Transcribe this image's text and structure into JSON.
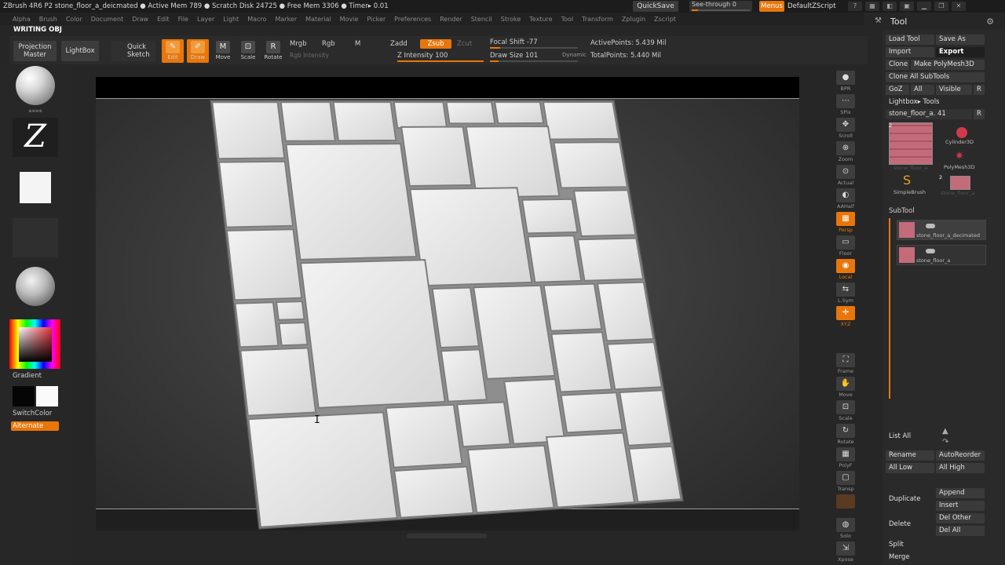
{
  "titlebar": {
    "app_title": "ZBrush 4R6 P2    stone_floor_a_deicmated    ● Active Mem 789 ● Scratch Disk 24725 ● Free Mem 3306 ● Timer▸ 0.01",
    "quicksave": "QuickSave",
    "see_through": "See-through   0",
    "see_through_value": 0,
    "menus": "Menus",
    "script": "DefaultZScript"
  },
  "menu": [
    "Alpha",
    "Brush",
    "Color",
    "Document",
    "Draw",
    "Edit",
    "File",
    "Layer",
    "Light",
    "Macro",
    "Marker",
    "Material",
    "Movie",
    "Picker",
    "Preferences",
    "Render",
    "Stencil",
    "Stroke",
    "Texture",
    "Tool",
    "Transform",
    "Zplugin",
    "Zscript"
  ],
  "document_label": "WRITING OBJ",
  "shelf": {
    "projection_master": "Projection Master",
    "lightbox": "LightBox",
    "quick_sketch": "Quick Sketch",
    "edit": "Edit",
    "draw": "Draw",
    "move": "Move",
    "scale": "Scale",
    "rotate": "Rotate",
    "mrgb": "Mrgb",
    "rgb": "Rgb",
    "m": "M",
    "rgb_intensity": "Rgb Intensity",
    "zadd": "Zadd",
    "zsub": "Zsub",
    "zcut": "Zcut",
    "z_intensity_label": "Z Intensity 100",
    "z_intensity": 100,
    "focal_shift_label": "Focal Shift -77",
    "focal_shift": -77,
    "draw_size_label": "Draw Size 101",
    "draw_size": 101,
    "dynamic": "Dynamic",
    "active_points": "ActivePoints: 5.439 Mil",
    "total_points": "TotalPoints: 5.440 Mil"
  },
  "left": {
    "gradient": "Gradient",
    "switch_color": "SwitchColor",
    "alternate": "Alternate",
    "primary_color": "#050505",
    "secondary_color": "#fafafa"
  },
  "right_shelf": [
    "BPR",
    "SPix",
    "Scroll",
    "Zoom",
    "Actual",
    "AAHalf",
    "Persp",
    "Floor",
    "Local",
    "L.Sym",
    "XYZ",
    "",
    "Frame",
    "Move",
    "Scale",
    "Rotate",
    "PolyF",
    "Transp",
    "",
    "Solo",
    "Xpose"
  ],
  "tool_panel": {
    "title": "Tool",
    "load_tool": "Load Tool",
    "save_as": "Save As",
    "import": "Import",
    "export": "Export",
    "clone": "Clone",
    "make_polymesh": "Make PolyMesh3D",
    "clone_all_subtools": "Clone All SubTools",
    "goz": "GoZ",
    "all": "All",
    "visible": "Visible",
    "r": "R",
    "lightbox_tools": "Lightbox▸ Tools",
    "current_tool": "stone_floor_a. 41",
    "tools": [
      {
        "name": "stone_floor_a",
        "index": "2"
      },
      {
        "name": "Cylinder3D"
      },
      {
        "name": "PolyMesh3D"
      },
      {
        "name": "SimpleBrush"
      },
      {
        "name": "stone_floor_a",
        "index": "2"
      }
    ],
    "subtool_head": "SubTool",
    "subtools": [
      {
        "name": "stone_floor_a_decimated"
      },
      {
        "name": "stone_floor_a"
      }
    ],
    "list_all": "List All",
    "rename": "Rename",
    "auto_reorder": "AutoReorder",
    "all_low": "All Low",
    "all_high": "All High",
    "duplicate": "Duplicate",
    "append": "Append",
    "insert": "Insert",
    "delete": "Delete",
    "del_other": "Del Other",
    "del_all": "Del All",
    "split": "Split",
    "merge": "Merge"
  },
  "colors": {
    "accent": "#e8760a",
    "panel": "#2a2a2a"
  }
}
